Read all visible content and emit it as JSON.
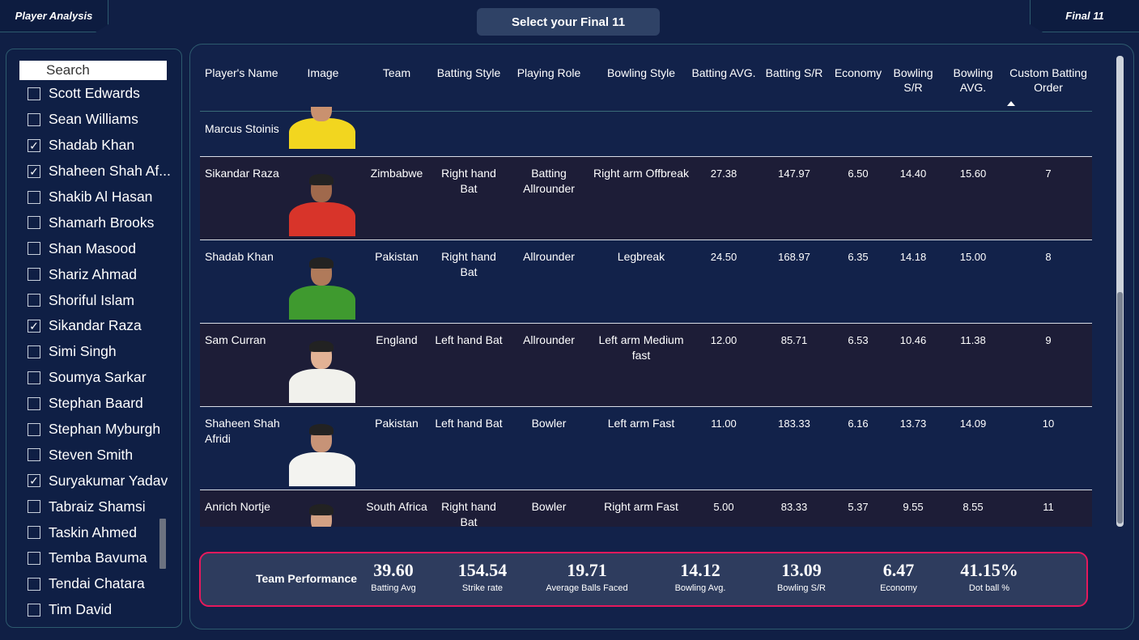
{
  "tabs": {
    "left": "Player Analysis",
    "right": "Final 11"
  },
  "header": {
    "title": "Select your Final 11"
  },
  "slicer": {
    "search_placeholder": "Search",
    "items": [
      {
        "label": "Scott Edwards",
        "checked": false
      },
      {
        "label": "Sean Williams",
        "checked": false
      },
      {
        "label": "Shadab Khan",
        "checked": true
      },
      {
        "label": "Shaheen Shah Af...",
        "checked": true
      },
      {
        "label": "Shakib Al Hasan",
        "checked": false
      },
      {
        "label": "Shamarh Brooks",
        "checked": false
      },
      {
        "label": "Shan Masood",
        "checked": false
      },
      {
        "label": "Shariz Ahmad",
        "checked": false
      },
      {
        "label": "Shoriful Islam",
        "checked": false
      },
      {
        "label": "Sikandar Raza",
        "checked": true
      },
      {
        "label": "Simi Singh",
        "checked": false
      },
      {
        "label": "Soumya Sarkar",
        "checked": false
      },
      {
        "label": "Stephan Baard",
        "checked": false
      },
      {
        "label": "Stephan Myburgh",
        "checked": false
      },
      {
        "label": "Steven Smith",
        "checked": false
      },
      {
        "label": "Suryakumar Yadav",
        "checked": true
      },
      {
        "label": "Tabraiz Shamsi",
        "checked": false
      },
      {
        "label": "Taskin Ahmed",
        "checked": false
      },
      {
        "label": "Temba Bavuma",
        "checked": false
      },
      {
        "label": "Tendai Chatara",
        "checked": false
      },
      {
        "label": "Tim David",
        "checked": false
      }
    ]
  },
  "table": {
    "columns": [
      "Player's Name",
      "Image",
      "Team",
      "Batting Style",
      "Playing Role",
      "Bowling Style",
      "Batting AVG.",
      "Batting S/R",
      "Economy",
      "Bowling S/R",
      "Bowling AVG.",
      "Custom Batting Order"
    ],
    "sorted_column": "Custom Batting Order",
    "rows": [
      {
        "name": "Marcus Stoinis",
        "team": "",
        "batting_style": "",
        "role": "",
        "bowling_style": "",
        "bat_avg": "",
        "bat_sr": "",
        "economy": "",
        "bowl_sr": "",
        "bowl_avg": "",
        "order": "",
        "jersey": "#f2d61f",
        "skin": "#c9916f"
      },
      {
        "name": "Sikandar Raza",
        "team": "Zimbabwe",
        "batting_style": "Right hand Bat",
        "role": "Batting Allrounder",
        "bowling_style": "Right arm Offbreak",
        "bat_avg": "27.38",
        "bat_sr": "147.97",
        "economy": "6.50",
        "bowl_sr": "14.40",
        "bowl_avg": "15.60",
        "order": "7",
        "jersey": "#d8342a",
        "skin": "#a0694c"
      },
      {
        "name": "Shadab Khan",
        "team": "Pakistan",
        "batting_style": "Right hand Bat",
        "role": "Allrounder",
        "bowling_style": "Legbreak",
        "bat_avg": "24.50",
        "bat_sr": "168.97",
        "economy": "6.35",
        "bowl_sr": "14.18",
        "bowl_avg": "15.00",
        "order": "8",
        "jersey": "#3f9a2f",
        "skin": "#b07a5a"
      },
      {
        "name": "Sam Curran",
        "team": "England",
        "batting_style": "Left hand Bat",
        "role": "Allrounder",
        "bowling_style": "Left arm Medium fast",
        "bat_avg": "12.00",
        "bat_sr": "85.71",
        "economy": "6.53",
        "bowl_sr": "10.46",
        "bowl_avg": "11.38",
        "order": "9",
        "jersey": "#f1f1ec",
        "skin": "#e2b295"
      },
      {
        "name": "Shaheen Shah Afridi",
        "team": "Pakistan",
        "batting_style": "Left hand Bat",
        "role": "Bowler",
        "bowling_style": "Left arm Fast",
        "bat_avg": "11.00",
        "bat_sr": "183.33",
        "economy": "6.16",
        "bowl_sr": "13.73",
        "bowl_avg": "14.09",
        "order": "10",
        "jersey": "#f3f3f0",
        "skin": "#c79377"
      },
      {
        "name": "Anrich Nortje",
        "team": "South Africa",
        "batting_style": "Right hand Bat",
        "role": "Bowler",
        "bowling_style": "Right arm Fast",
        "bat_avg": "5.00",
        "bat_sr": "83.33",
        "economy": "5.37",
        "bowl_sr": "9.55",
        "bowl_avg": "8.55",
        "order": "11",
        "jersey": "#1f7a3c",
        "skin": "#d2a184"
      }
    ]
  },
  "performance": {
    "title": "Team Performance",
    "kpis": [
      {
        "value": "39.60",
        "label": "Batting Avg"
      },
      {
        "value": "154.54",
        "label": "Strike rate"
      },
      {
        "value": "19.71",
        "label": "Average Balls Faced"
      },
      {
        "value": "14.12",
        "label": "Bowling Avg."
      },
      {
        "value": "13.09",
        "label": "Bowling S/R"
      },
      {
        "value": "6.47",
        "label": "Economy"
      },
      {
        "value": "41.15%",
        "label": "Dot ball %"
      }
    ]
  },
  "colors": {
    "background": "#101f45",
    "accent_border": "#e6195c",
    "panel_border": "#2d5a6e"
  }
}
